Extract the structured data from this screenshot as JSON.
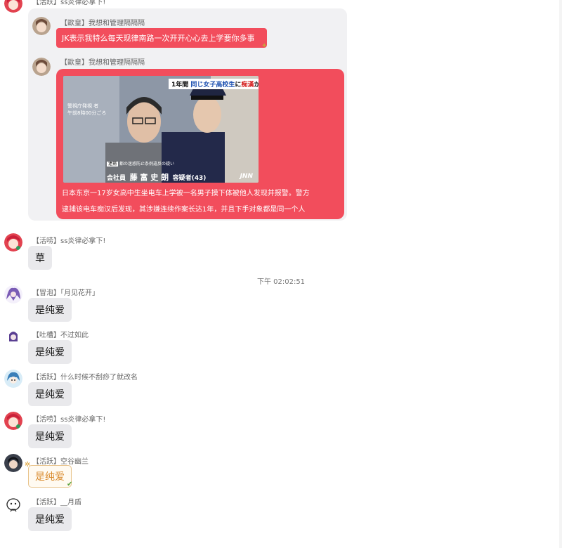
{
  "top_partial_sender": "【活跃】ss炎律必拿下!",
  "quote": {
    "row1": {
      "sender": "【歐皇】我想和管理隔隔隔",
      "text": "JK表示我特么每天现律南路一次开开心心去上学要你多事"
    },
    "row2": {
      "sender": "【歐皇】我想和管理隔隔隔",
      "image": {
        "banner_prefix": "1年間",
        "banner_highlight": "同じ女子高校生",
        "banner_mid": "に",
        "banner_red": "痴漢",
        "banner_suffix": "か",
        "side_caption_line1": "警視庁発視 者",
        "side_caption_line2": "午前8時00分ごろ",
        "tag": "逮捕",
        "tag_note": "都の迷惑防止条例違反の疑い",
        "company": "会社員",
        "name": "藤 富 史 朗",
        "title": "容疑者(43)",
        "logo": "JNN"
      },
      "text_line1": "日本东京一17岁女高中生坐电车上学被一名男子摸下体被他人发现并报警。警方",
      "text_line2": "逮捕该电车痴汉后发现，其涉嫌连续作案长达1年，并且下手对象都是同一个人"
    }
  },
  "messages": [
    {
      "sender": "【活唠】ss炎律必拿下!",
      "text": "草",
      "avatar": "red-hair-avatar-icon"
    },
    {
      "sender": "【冒泡】「月见花开」",
      "text": "是纯爱",
      "avatar": "purple-hair-avatar-icon"
    },
    {
      "sender": "【吐槽】不过如此",
      "text": "是纯爱",
      "avatar": "purple-chibi-avatar-icon"
    },
    {
      "sender": "【活跃】什么时候不刮痧了就改名",
      "text": "是纯爱",
      "avatar": "blue-hair-avatar-icon"
    },
    {
      "sender": "【活唠】ss炎律必拿下!",
      "text": "是纯爱",
      "avatar": "red-hair-avatar-icon"
    },
    {
      "sender": "【活跃】空谷幽兰",
      "text": "是纯爱",
      "avatar": "dark-hair-avatar-icon"
    },
    {
      "sender": "【活跃】__月盾",
      "text": "是纯爱",
      "avatar": "sketch-face-avatar-icon"
    }
  ],
  "timestamp": "下午 02:02:51",
  "colors": {
    "red_bubble": "#f24d5c",
    "gray_bubble": "#e9e9ec",
    "quote_card": "#f1f1f3",
    "special_bubble_border": "#e8c38a",
    "special_bubble_text": "#d98a2c"
  }
}
